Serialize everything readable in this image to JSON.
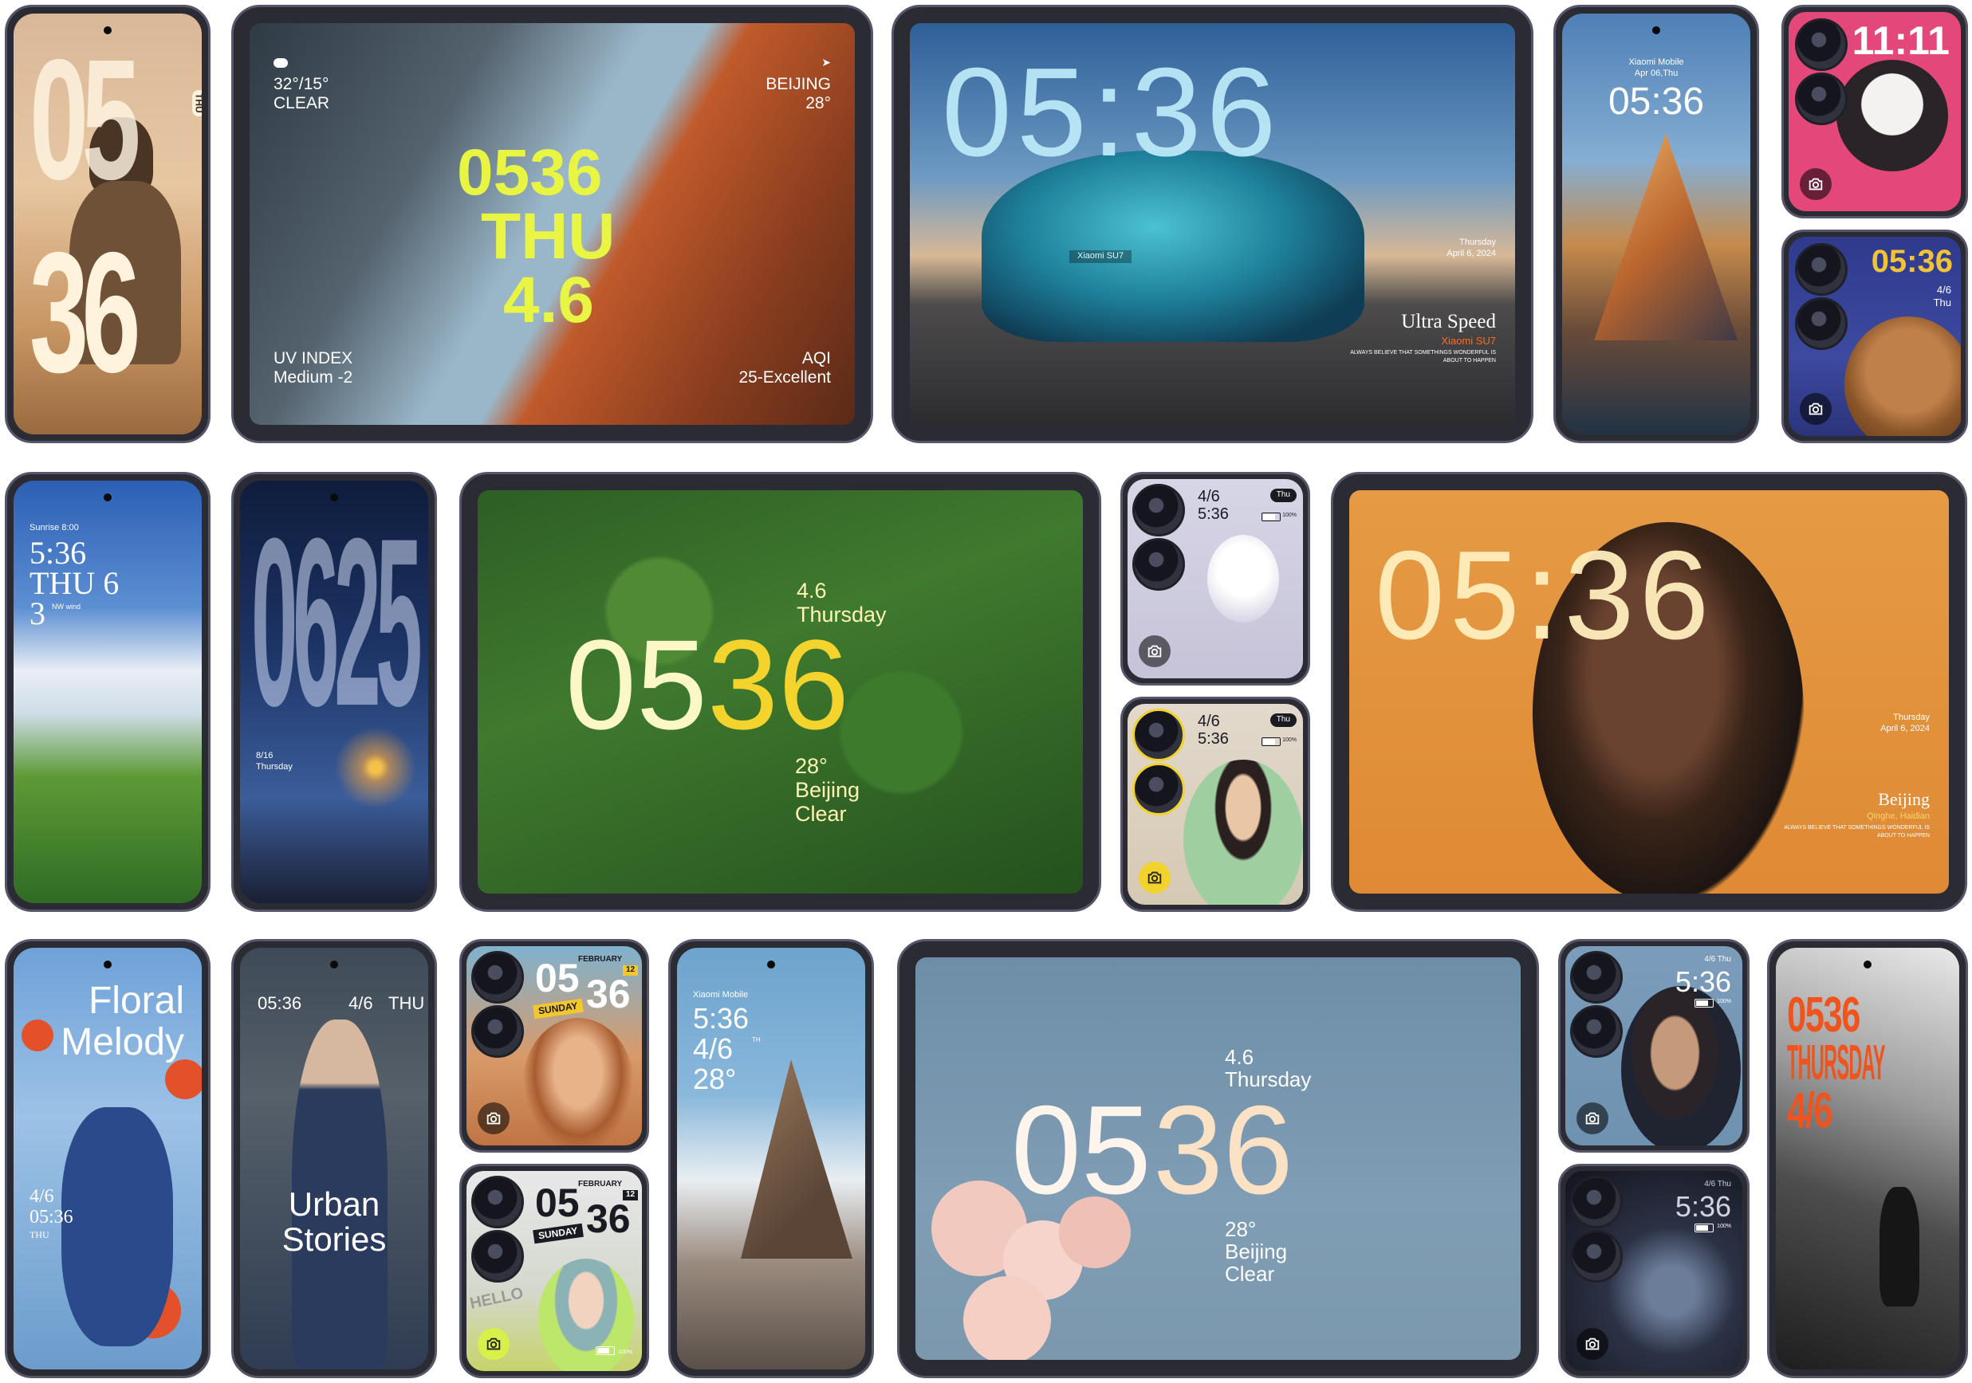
{
  "d1": {
    "time_top": "05",
    "time_bottom": "36",
    "day": "THU"
  },
  "d2": {
    "temp": "32°/15°",
    "weather": "CLEAR",
    "city": "BEIJING",
    "city_temp": "28°",
    "time": "0536",
    "weekday": "THU",
    "date": "4.6",
    "uv_label": "UV INDEX",
    "uv_value": "Medium -2",
    "aqi_label": "AQI",
    "aqi_value": "25-Excellent"
  },
  "d3": {
    "time": "05:36",
    "car_badge": "Xiaomi SU7",
    "weekday": "Thursday",
    "date": "April 6, 2024",
    "title": "Ultra Speed",
    "subtitle": "Xiaomi SU7",
    "tagline1": "ALWAYS BELIEVE THAT SOMETHINGS WONDERFUL IS",
    "tagline2": "ABOUT TO HAPPEN"
  },
  "d4": {
    "brand": "Xiaomi Mobile",
    "date": "Apr 06,Thu",
    "time": "05:36"
  },
  "d5": {
    "time": "11:11"
  },
  "d6": {
    "time": "05:36",
    "date": "4/6",
    "day": "Thu"
  },
  "d7": {
    "sunrise": "Sunrise 8:00",
    "time": "5:36",
    "date": "THU 6",
    "wind": "3",
    "wind_label": "NW wind"
  },
  "d8": {
    "time": "0625",
    "date": "8/16",
    "day": "Thursday"
  },
  "d9": {
    "date": "4.6",
    "weekday": "Thursday",
    "time_a": "05",
    "time_b": "36",
    "temp": "28°",
    "city": "Beijing",
    "weather": "Clear"
  },
  "d10": {
    "date": "4/6",
    "time": "5:36",
    "day": "Thu",
    "battery": "100%"
  },
  "d11": {
    "date": "4/6",
    "time": "5:36",
    "day": "Thu",
    "battery": "100%"
  },
  "d12": {
    "time": "05:36",
    "weekday": "Thursday",
    "date": "April 6, 2024",
    "city": "Beijing",
    "district": "Qinghe, Haidian",
    "tagline1": "ALWAYS BELIEVE THAT SOMETHINGS WONDERFUL IS",
    "tagline2": "ABOUT TO HAPPEN"
  },
  "d13": {
    "title_line1": "Floral",
    "title_line2": "Melody",
    "date": "4/6",
    "time": "05:36",
    "day": "THU"
  },
  "d14": {
    "time": "05:36",
    "date": "4/6",
    "day": "THU",
    "title_line1": "Urban",
    "title_line2": "Stories"
  },
  "d15": {
    "time_a": "05",
    "time_b": "36",
    "month": "FEBRUARY",
    "day_num": "12",
    "weekday": "SUNDAY"
  },
  "d16": {
    "time_a": "05",
    "time_b": "36",
    "month": "FEBRUARY",
    "day_num": "12",
    "weekday": "SUNDAY",
    "sticker": "HELLO",
    "battery": "100%"
  },
  "d17": {
    "brand": "Xiaomi Mobile",
    "time": "5:36",
    "date": "4/6",
    "date_suffix": "TH",
    "temp": "28°"
  },
  "d18": {
    "date": "4.6",
    "weekday": "Thursday",
    "time_a": "05",
    "time_b": "36",
    "temp": "28°",
    "city": "Beijing",
    "weather": "Clear"
  },
  "d19": {
    "date": "4/6 Thu",
    "time": "5:36",
    "battery": "100%"
  },
  "d20": {
    "date": "4/6 Thu",
    "time": "5:36",
    "battery": "100%"
  },
  "d21": {
    "time": "0536",
    "weekday": "THURSDAY",
    "date": "4/6"
  }
}
